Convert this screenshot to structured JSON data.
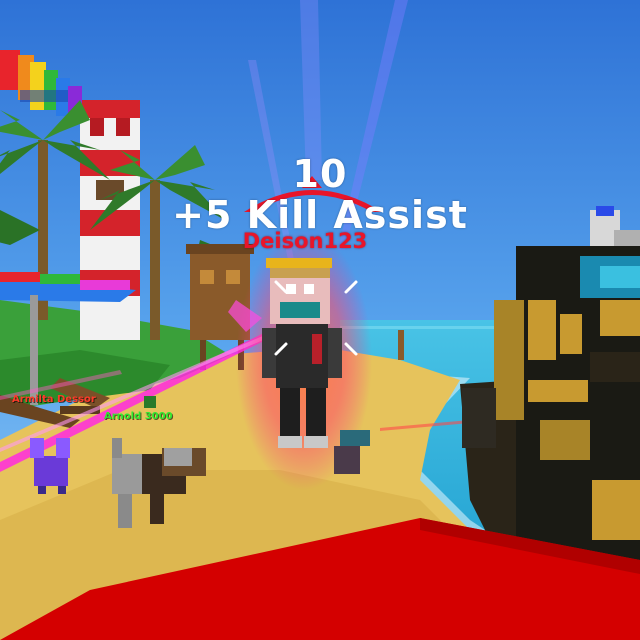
{
  "hud": {
    "score": "10",
    "kill_event": "+5 Kill Assist",
    "target_name": "Deison123"
  },
  "nameplates": [
    {
      "name": "Armilta Dessor",
      "color": "#ff3a2a"
    },
    {
      "name": "Arnold 3000",
      "color": "#2fe82f"
    }
  ],
  "colors": {
    "sky": "#4a8fe0",
    "sand": "#e8c25a",
    "water": "#36c8e8",
    "kill_red": "#e8152a",
    "crosshair": "#e8152a",
    "laser": "#ff2adf"
  },
  "icons": {
    "crosshair": "crosshair-icon",
    "hit_marker": "hit-marker-icon"
  }
}
